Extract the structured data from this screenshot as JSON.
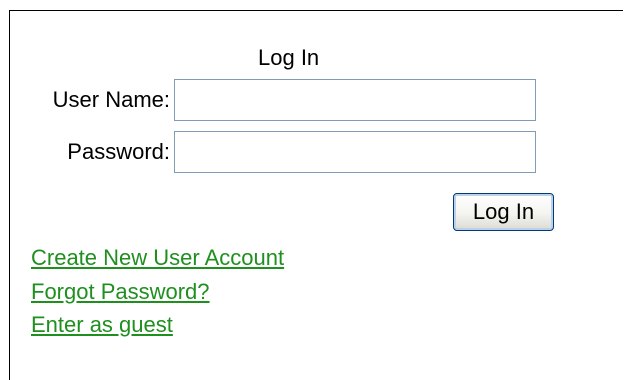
{
  "login": {
    "title": "Log In",
    "username_label": "User Name:",
    "username_value": "",
    "password_label": "Password:",
    "password_value": "",
    "submit_label": "Log In"
  },
  "links": {
    "create_account": "Create New User Account",
    "forgot_password": "Forgot Password?",
    "guest": "Enter as guest"
  },
  "colors": {
    "link": "#1f8f1f",
    "input_border": "#7f9db9",
    "button_border": "#003c74"
  }
}
